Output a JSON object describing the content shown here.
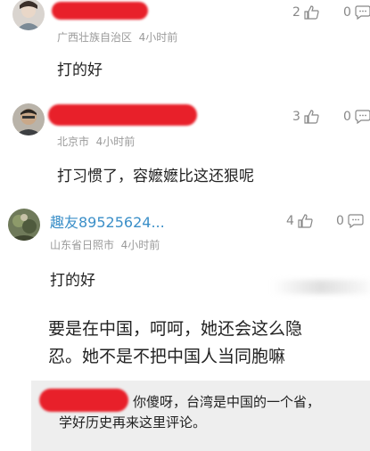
{
  "comments": [
    {
      "location": "广西壮族自治区",
      "time": "4小时前",
      "likes": "2",
      "replies": "0",
      "text": "打的好"
    },
    {
      "location": "北京市",
      "time": "4小时前",
      "likes": "3",
      "replies": "0",
      "text": "打习惯了，容嬷嬷比这还狠呢"
    },
    {
      "username": "趣友89525624...",
      "location": "山东省日照市",
      "time": "4小时前",
      "likes": "4",
      "replies": "0",
      "text": "打的好"
    }
  ],
  "post": {
    "line1": "要是在中国，呵呵，她还会这么隐",
    "line2": "忍。她不是不把中国人当同胞嘛"
  },
  "reply": {
    "line1": "你傻呀，台湾是中国的一个省，",
    "line2": "学好历史再来这里评论。"
  },
  "icons": {
    "like": "thumbs-up-icon",
    "reply": "comment-bubble-icon"
  },
  "colors": {
    "username": "#3b8fc8",
    "redaction": "#e8202a",
    "meta": "#9a9a9a"
  }
}
